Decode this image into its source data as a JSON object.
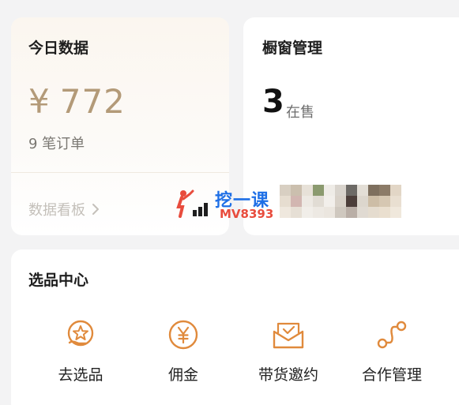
{
  "today": {
    "title": "今日数据",
    "currency": "¥",
    "amount": "772",
    "orders": "9 笔订单",
    "board_link": "数据看板"
  },
  "showcase": {
    "title": "橱窗管理",
    "count": "3",
    "count_label": "在售"
  },
  "watermark": {
    "brand": "挖一课",
    "code": "MV8393"
  },
  "select_center": {
    "title": "选品中心",
    "tools": [
      {
        "label": "去选品",
        "icon": "hand-star-icon"
      },
      {
        "label": "佣金",
        "icon": "yen-coin-icon"
      },
      {
        "label": "带货邀约",
        "icon": "envelope-check-icon"
      },
      {
        "label": "合作管理",
        "icon": "cooperation-nodes-icon"
      }
    ]
  },
  "colors": {
    "accent": "#e08a3c",
    "amount": "#b39a78",
    "background": "#f3f3f4"
  }
}
